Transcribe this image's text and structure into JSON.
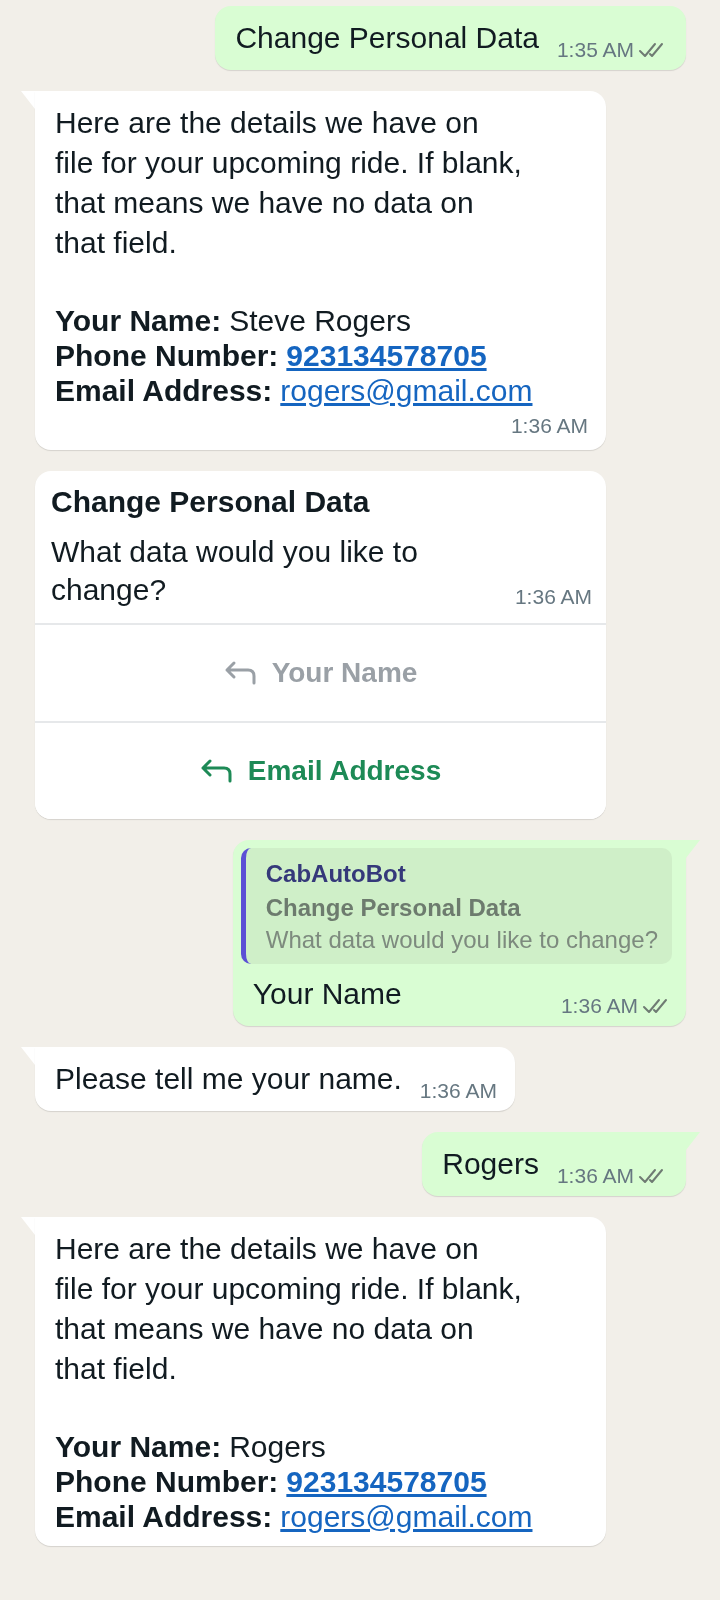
{
  "messages": [
    {
      "kind": "text",
      "outgoing": true,
      "tail": false,
      "text": "Change Personal Data",
      "time": "1:35 AM"
    },
    {
      "kind": "details",
      "outgoing": false,
      "tail": true,
      "intro": "Here are the details we have on file for your upcoming ride. If blank, that means we have no data on that field.",
      "fields": [
        {
          "label": "Your Name:",
          "value": "Steve Rogers",
          "kind": "plain"
        },
        {
          "label": "Phone Number:",
          "value": "923134578705",
          "kind": "phone"
        },
        {
          "label": "Email Address:",
          "value": "rogers@gmail.com",
          "kind": "email"
        }
      ],
      "time": "1:36 AM"
    },
    {
      "kind": "buttons",
      "outgoing": false,
      "tail": false,
      "title": "Change Personal Data",
      "text": "What data would you like to change?",
      "time": "1:36 AM",
      "buttons": [
        {
          "label": "Your Name",
          "disabled": true
        },
        {
          "label": "Email Address",
          "disabled": false
        }
      ]
    },
    {
      "kind": "reply",
      "outgoing": true,
      "tail": true,
      "quote": {
        "sender": "CabAutoBot",
        "title": "Change Personal Data",
        "text": "What data would you like to change?"
      },
      "text": "Your Name",
      "time": "1:36 AM"
    },
    {
      "kind": "text",
      "outgoing": false,
      "tail": true,
      "text": "Please tell me your name.",
      "time": "1:36 AM"
    },
    {
      "kind": "text",
      "outgoing": true,
      "tail": true,
      "text": "Rogers",
      "time": "1:36 AM"
    },
    {
      "kind": "details",
      "outgoing": false,
      "tail": true,
      "intro": "Here are the details we have on file for your upcoming ride. If blank, that means we have no data on that field.",
      "fields": [
        {
          "label": "Your Name:",
          "value": "Rogers",
          "kind": "plain"
        },
        {
          "label": "Phone Number:",
          "value": "923134578705",
          "kind": "phone"
        },
        {
          "label": "Email Address:",
          "value": "rogers@gmail.com",
          "kind": "email"
        }
      ]
    }
  ]
}
